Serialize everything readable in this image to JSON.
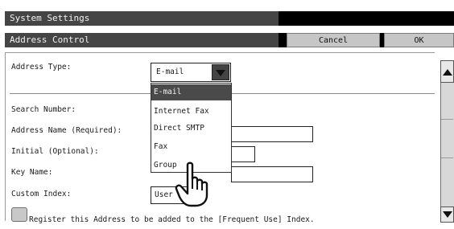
{
  "header": {
    "title": "System Settings",
    "subtitle": "Address Control",
    "cancel_label": "Cancel",
    "ok_label": "OK"
  },
  "form": {
    "address_type_label": "Address Type:",
    "address_type_value": "E-mail",
    "search_number_label": "Search Number:",
    "address_name_label": "Address Name (Required):",
    "initial_label": "Initial (Optional):",
    "key_name_label": "Key Name:",
    "custom_index_label": "Custom Index:",
    "custom_index_value": "User 1",
    "frequent_use_label": "Register this Address to be added to the [Frequent Use] Index."
  },
  "dropdown": {
    "options": [
      "E-mail",
      "Internet Fax",
      "Direct SMTP",
      "Fax",
      "Group"
    ],
    "selected_index": 0
  },
  "colors": {
    "title_bar": "#454545",
    "selected_option": "#4a4a4a",
    "button_gray": "#c6c6c6"
  },
  "icons": {
    "cursor": "pointing-hand-icon",
    "dropdown_arrow": "chevron-down-icon",
    "scroll_up": "arrow-up-icon",
    "scroll_down": "arrow-down-icon"
  }
}
